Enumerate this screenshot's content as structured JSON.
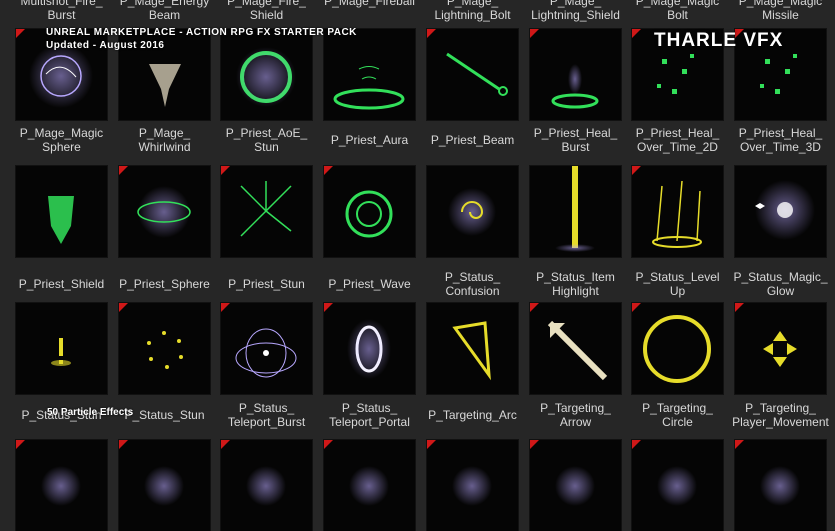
{
  "overlay": {
    "title": "UNREAL MARKETPLACE - ACTION RPG FX STARTER PACK",
    "updated": "Updated - August 2016",
    "brand": "THARLE VFX",
    "count": "50 Particle Effects"
  },
  "colors": {
    "green": "#32e05a",
    "yellow": "#e6dc2a",
    "violet": "#b8a8ff",
    "flag": "#d01818"
  },
  "top_labels": [
    "Multishot_Fire_\nBurst",
    "P_Mage_Energy\nBeam",
    "P_Mage_Fire_\nShield",
    "P_Mage_Fireball",
    "P_Mage_\nLightning_Bolt",
    "P_Mage_\nLightning_Shield",
    "P_Mage_Magic\nBolt",
    "P_Mage_Magic\nMissile"
  ],
  "rows": [
    {
      "items": [
        {
          "label": "P_Mage_Magic\nSphere",
          "icon": "violet-sphere-icon",
          "flag": true
        },
        {
          "label": "P_Mage_\nWhirlwind",
          "icon": "whirlwind-icon",
          "flag": false
        },
        {
          "label": "P_Priest_AoE_\nStun",
          "icon": "green-ring-icon",
          "flag": false
        },
        {
          "label": "P_Priest_Aura",
          "icon": "green-aura-icon",
          "flag": false
        },
        {
          "label": "P_Priest_Beam",
          "icon": "green-beam-icon",
          "flag": true
        },
        {
          "label": "P_Priest_Heal_\nBurst",
          "icon": "green-burst-icon",
          "flag": true
        },
        {
          "label": "P_Priest_Heal_\nOver_Time_2D",
          "icon": "green-sparkles-icon",
          "flag": true
        },
        {
          "label": "P_Priest_Heal_\nOver_Time_3D",
          "icon": "green-sparkles-icon",
          "flag": true
        }
      ]
    },
    {
      "items": [
        {
          "label": "P_Priest_Shield",
          "icon": "green-shield-icon",
          "flag": false
        },
        {
          "label": "P_Priest_Sphere",
          "icon": "green-sphere-icon",
          "flag": true
        },
        {
          "label": "P_Priest_Stun",
          "icon": "green-stun-icon",
          "flag": true
        },
        {
          "label": "P_Priest_Wave",
          "icon": "green-wave-icon",
          "flag": true
        },
        {
          "label": "P_Status_\nConfusion",
          "icon": "yellow-swirl-icon",
          "flag": false
        },
        {
          "label": "P_Status_Item\nHighlight",
          "icon": "yellow-beam-icon",
          "flag": false
        },
        {
          "label": "P_Status_Level\nUp",
          "icon": "yellow-levelup-icon",
          "flag": true
        },
        {
          "label": "P_Status_Magic_\nGlow",
          "icon": "violet-glow-icon",
          "flag": false
        }
      ]
    },
    {
      "items": [
        {
          "label": "P_Status_Stun",
          "icon": "yellow-exclaim-icon",
          "flag": false
        },
        {
          "label": "P_Status_Stun",
          "icon": "yellow-ring-dots-icon",
          "flag": true
        },
        {
          "label": "P_Status_\nTeleport_Burst",
          "icon": "violet-burst-icon",
          "flag": true
        },
        {
          "label": "P_Status_\nTeleport_Portal",
          "icon": "violet-portal-icon",
          "flag": true
        },
        {
          "label": "P_Targeting_Arc",
          "icon": "yellow-arc-icon",
          "flag": false
        },
        {
          "label": "P_Targeting_\nArrow",
          "icon": "yellow-arrow-icon",
          "flag": true
        },
        {
          "label": "P_Targeting_\nCircle",
          "icon": "yellow-circle-icon",
          "flag": true
        },
        {
          "label": "P_Targeting_\nPlayer_Movement",
          "icon": "yellow-target-icon",
          "flag": true
        }
      ]
    },
    {
      "items": [
        {
          "icon": "effect-icon",
          "flag": true
        },
        {
          "icon": "effect-icon",
          "flag": true
        },
        {
          "icon": "effect-icon",
          "flag": true
        },
        {
          "icon": "effect-icon",
          "flag": true
        },
        {
          "icon": "effect-icon",
          "flag": true
        },
        {
          "icon": "effect-icon",
          "flag": true
        },
        {
          "icon": "effect-icon",
          "flag": true
        },
        {
          "icon": "effect-icon",
          "flag": true
        }
      ]
    }
  ]
}
